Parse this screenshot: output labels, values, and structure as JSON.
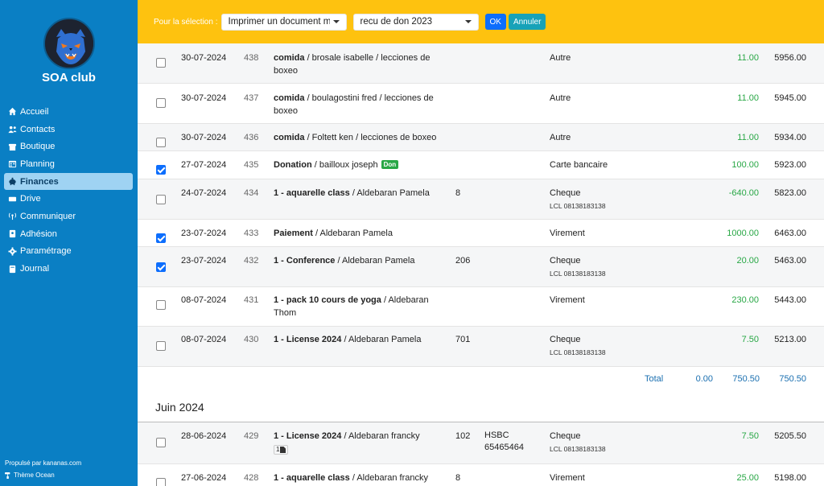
{
  "app": {
    "club_name": "SOA club",
    "footer_powered": "Propulsé par kananas.com",
    "footer_theme": "Thème Ocean"
  },
  "nav": [
    {
      "label": "Accueil",
      "icon": "home-icon",
      "active": false
    },
    {
      "label": "Contacts",
      "icon": "users-icon",
      "active": false
    },
    {
      "label": "Boutique",
      "icon": "store-icon",
      "active": false
    },
    {
      "label": "Planning",
      "icon": "calendar-icon",
      "active": false
    },
    {
      "label": "Finances",
      "icon": "piggy-bank-icon",
      "active": true
    },
    {
      "label": "Drive",
      "icon": "drive-icon",
      "active": false
    },
    {
      "label": "Communiquer",
      "icon": "broadcast-icon",
      "active": false
    },
    {
      "label": "Adhésion",
      "icon": "id-card-icon",
      "active": false
    },
    {
      "label": "Paramétrage",
      "icon": "gear-icon",
      "active": false
    },
    {
      "label": "Journal",
      "icon": "book-icon",
      "active": false
    }
  ],
  "toolbar": {
    "label": "Pour la sélection :",
    "action_select": "Imprimer un document m",
    "document_select": "recu de don 2023",
    "ok": "OK",
    "cancel": "Annuler"
  },
  "rows": [
    {
      "checked": false,
      "date": "30-07-2024",
      "num": "438",
      "title": "comida",
      "rest": " / brosale isabelle / lecciones de boxeo",
      "qty": "",
      "bank": "",
      "pay": "Autre",
      "pay_sub": "",
      "amount": "11.00",
      "balance": "5956.00",
      "badge": ""
    },
    {
      "checked": false,
      "date": "30-07-2024",
      "num": "437",
      "title": "comida",
      "rest": " / boulagostini fred / lecciones de boxeo",
      "qty": "",
      "bank": "",
      "pay": "Autre",
      "pay_sub": "",
      "amount": "11.00",
      "balance": "5945.00",
      "badge": ""
    },
    {
      "checked": false,
      "date": "30-07-2024",
      "num": "436",
      "title": "comida",
      "rest": " / Foltett ken / lecciones de boxeo",
      "qty": "",
      "bank": "",
      "pay": "Autre",
      "pay_sub": "",
      "amount": "11.00",
      "balance": "5934.00",
      "badge": ""
    },
    {
      "checked": true,
      "date": "27-07-2024",
      "num": "435",
      "title": "Donation",
      "rest": " / bailloux joseph",
      "qty": "",
      "bank": "",
      "pay": "Carte bancaire",
      "pay_sub": "",
      "amount": "100.00",
      "balance": "5923.00",
      "badge": "Don"
    },
    {
      "checked": false,
      "date": "24-07-2024",
      "num": "434",
      "title": "1 - aquarelle class",
      "rest": " / Aldebaran Pamela",
      "qty": "8",
      "bank": "",
      "pay": "Cheque",
      "pay_sub": "LCL 08138183138",
      "amount": "-640.00",
      "balance": "5823.00",
      "badge": ""
    },
    {
      "checked": true,
      "date": "23-07-2024",
      "num": "433",
      "title": "Paiement",
      "rest": " / Aldebaran Pamela",
      "qty": "",
      "bank": "",
      "pay": "Virement",
      "pay_sub": "",
      "amount": "1000.00",
      "balance": "6463.00",
      "badge": ""
    },
    {
      "checked": true,
      "date": "23-07-2024",
      "num": "432",
      "title": "1 - Conference",
      "rest": " / Aldebaran Pamela",
      "qty": "206",
      "bank": "",
      "pay": "Cheque",
      "pay_sub": "LCL 08138183138",
      "amount": "20.00",
      "balance": "5463.00",
      "badge": ""
    },
    {
      "checked": false,
      "date": "08-07-2024",
      "num": "431",
      "title": "1 - pack 10 cours de yoga",
      "rest": " / Aldebaran Thom",
      "qty": "",
      "bank": "",
      "pay": "Virement",
      "pay_sub": "",
      "amount": "230.00",
      "balance": "5443.00",
      "badge": ""
    },
    {
      "checked": false,
      "date": "08-07-2024",
      "num": "430",
      "title": "1 - License 2024",
      "rest": " / Aldebaran Pamela",
      "qty": "701",
      "bank": "",
      "pay": "Cheque",
      "pay_sub": "LCL 08138183138",
      "amount": "7.50",
      "balance": "5213.00",
      "badge": ""
    }
  ],
  "totals": {
    "label": "Total",
    "v1": "0.00",
    "v2": "750.50",
    "v3": "750.50"
  },
  "month2": {
    "title": "Juin 2024",
    "rows": [
      {
        "checked": false,
        "date": "28-06-2024",
        "num": "429",
        "title": "1 - License 2024",
        "rest": " / Aldebaran francky",
        "qty": "102",
        "bank": "HSBC 65465464",
        "pay": "Cheque",
        "pay_sub": "LCL 08138183138",
        "amount": "7.50",
        "balance": "5205.50",
        "doc_count": "1"
      },
      {
        "checked": false,
        "date": "27-06-2024",
        "num": "428",
        "title": "1 - aquarelle class",
        "rest": " / Aldebaran francky",
        "qty": "8",
        "bank": "",
        "pay": "Virement",
        "pay_sub": "",
        "amount": "25.00",
        "balance": "5198.00"
      }
    ]
  },
  "colors": {
    "sidebar": "#0a7fc4",
    "toolbar": "#fec20f",
    "positive": "#28a745",
    "total": "#1a6fb0"
  }
}
